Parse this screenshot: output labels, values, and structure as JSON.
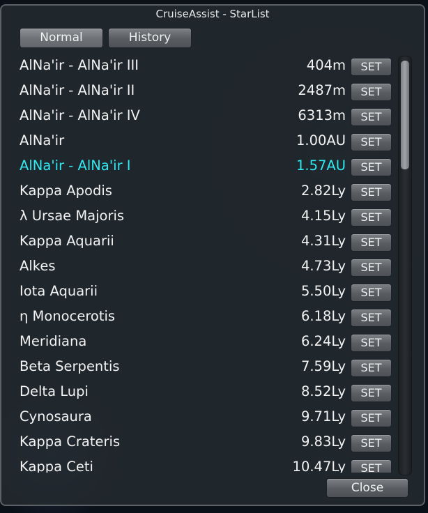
{
  "window": {
    "title": "CruiseAssist - StarList"
  },
  "tabs": {
    "normal": "Normal",
    "history": "History"
  },
  "set_label": "SET",
  "close_label": "Close",
  "colors": {
    "highlight": "#2fe8f0",
    "text": "#f2f2f2"
  },
  "stars": [
    {
      "name": "AlNa'ir - AlNa'ir III",
      "distance": "404m",
      "highlighted": false
    },
    {
      "name": "AlNa'ir - AlNa'ir II",
      "distance": "2487m",
      "highlighted": false
    },
    {
      "name": "AlNa'ir - AlNa'ir IV",
      "distance": "6313m",
      "highlighted": false
    },
    {
      "name": "AlNa'ir",
      "distance": "1.00AU",
      "highlighted": false
    },
    {
      "name": "AlNa'ir - AlNa'ir I",
      "distance": "1.57AU",
      "highlighted": true
    },
    {
      "name": "Kappa Apodis",
      "distance": "2.82Ly",
      "highlighted": false
    },
    {
      "name": "λ Ursae Majoris",
      "distance": "4.15Ly",
      "highlighted": false
    },
    {
      "name": "Kappa Aquarii",
      "distance": "4.31Ly",
      "highlighted": false
    },
    {
      "name": "Alkes",
      "distance": "4.73Ly",
      "highlighted": false
    },
    {
      "name": "Iota Aquarii",
      "distance": "5.50Ly",
      "highlighted": false
    },
    {
      "name": "η Monocerotis",
      "distance": "6.18Ly",
      "highlighted": false
    },
    {
      "name": "Meridiana",
      "distance": "6.24Ly",
      "highlighted": false
    },
    {
      "name": "Beta Serpentis",
      "distance": "7.59Ly",
      "highlighted": false
    },
    {
      "name": "Delta Lupi",
      "distance": "8.52Ly",
      "highlighted": false
    },
    {
      "name": "Cynosaura",
      "distance": "9.71Ly",
      "highlighted": false
    },
    {
      "name": "Kappa Crateris",
      "distance": "9.83Ly",
      "highlighted": false
    },
    {
      "name": "Kappa Ceti",
      "distance": "10.47Ly",
      "highlighted": false
    }
  ]
}
